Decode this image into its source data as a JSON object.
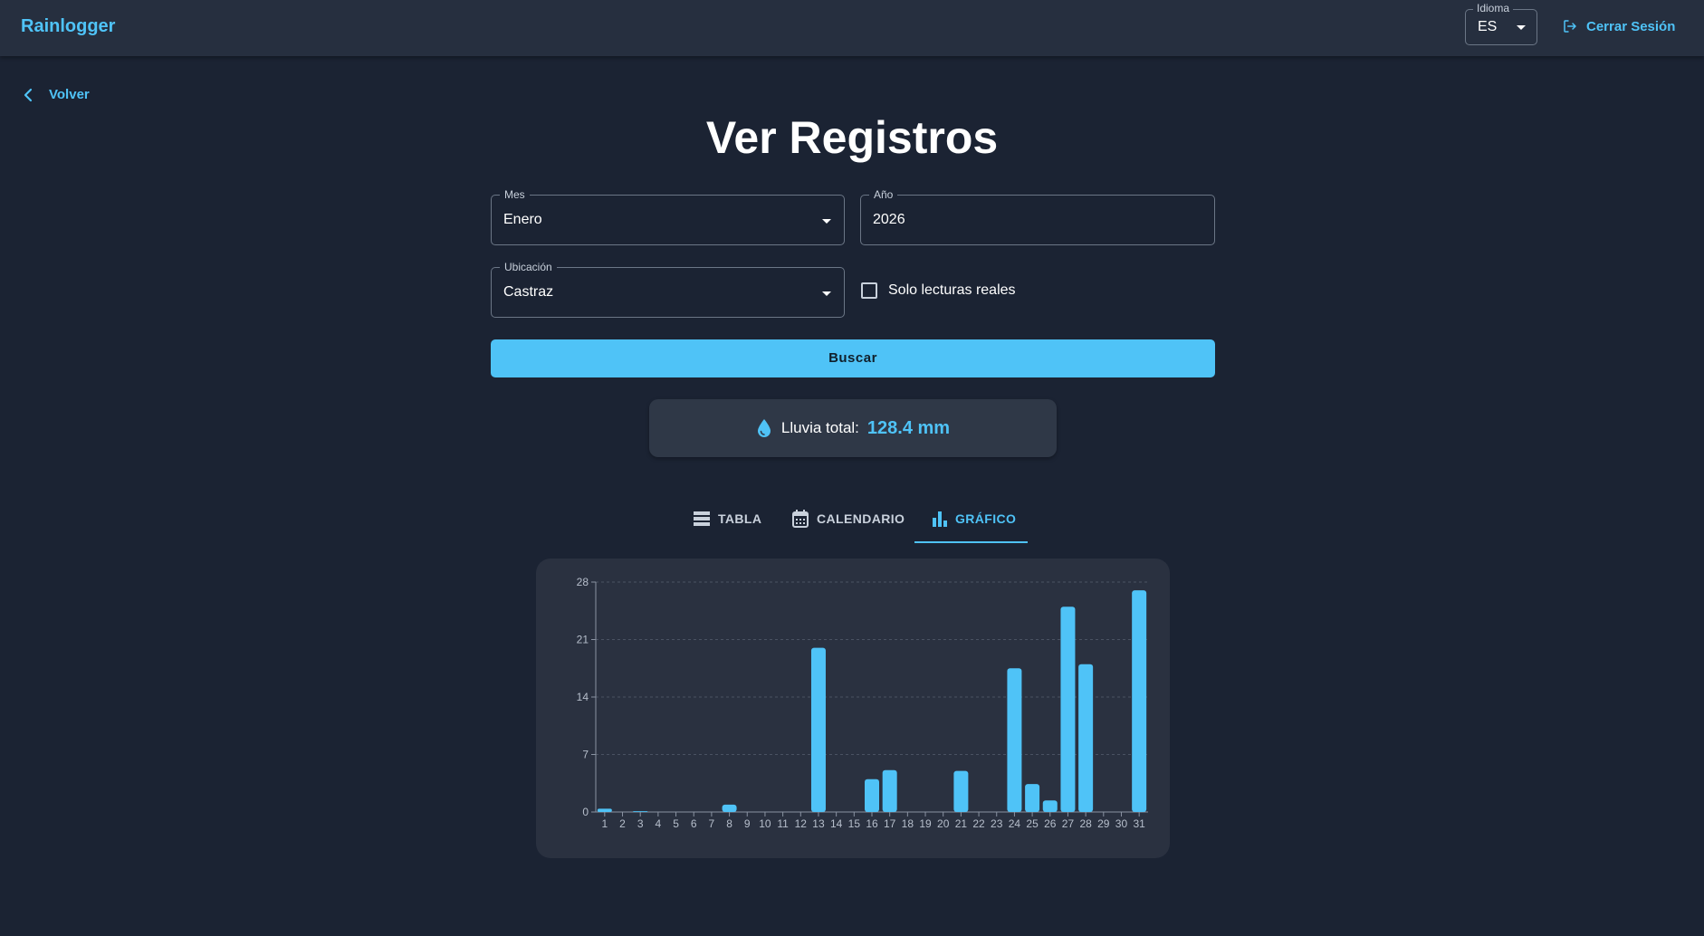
{
  "header": {
    "brand": "Rainlogger",
    "language_label": "Idioma",
    "language_value": "ES",
    "logout_label": "Cerrar Sesión"
  },
  "nav": {
    "back_label": "Volver"
  },
  "page": {
    "title": "Ver Registros"
  },
  "form": {
    "month": {
      "label": "Mes",
      "value": "Enero"
    },
    "year": {
      "label": "Año",
      "value": "2026"
    },
    "location": {
      "label": "Ubicación",
      "value": "Castraz"
    },
    "only_real": {
      "label": "Solo lecturas reales",
      "checked": false
    },
    "search_label": "Buscar"
  },
  "summary": {
    "label": "Lluvia total:",
    "value": "128.4 mm"
  },
  "tabs": [
    {
      "label": "TABLA",
      "icon": "table-rows-icon",
      "active": false
    },
    {
      "label": "CALENDARIO",
      "icon": "calendar-icon",
      "active": false
    },
    {
      "label": "GRÁFICO",
      "icon": "bar-chart-icon",
      "active": true
    }
  ],
  "colors": {
    "accent": "#4fc3f7",
    "background": "#1b2333",
    "surface": "#2a3140"
  },
  "chart_data": {
    "type": "bar",
    "categories": [
      "1",
      "2",
      "3",
      "4",
      "5",
      "6",
      "7",
      "8",
      "9",
      "10",
      "11",
      "12",
      "13",
      "14",
      "15",
      "16",
      "17",
      "18",
      "19",
      "20",
      "21",
      "22",
      "23",
      "24",
      "25",
      "26",
      "27",
      "28",
      "29",
      "30",
      "31"
    ],
    "values": [
      0.4,
      0,
      0.1,
      0,
      0,
      0,
      0,
      0.9,
      0,
      0,
      0,
      0,
      20.0,
      0,
      0,
      4.0,
      5.1,
      0,
      0,
      0,
      5.0,
      0,
      0,
      17.5,
      3.4,
      1.4,
      25.0,
      18.0,
      0,
      0,
      27.0
    ],
    "yticks": [
      0,
      7,
      14,
      21,
      28
    ],
    "ylim": [
      0,
      28
    ],
    "grid": "horizontal dashed",
    "xlabel": "",
    "ylabel": ""
  }
}
